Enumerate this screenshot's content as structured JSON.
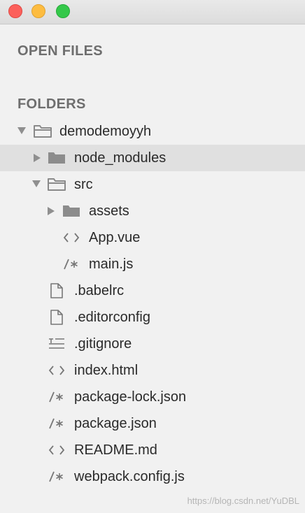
{
  "window": {
    "buttons": {
      "close": "close-button",
      "minimize": "minimize-button",
      "maximize": "zoom-button"
    }
  },
  "sidebar": {
    "open_files_title": "OPEN FILES",
    "folders_title": "FOLDERS",
    "tree": [
      {
        "label": "demodemoyyh",
        "type": "folder",
        "expanded": true,
        "icon": "folder-open-icon"
      },
      {
        "label": "node_modules",
        "type": "folder",
        "expanded": false,
        "selected": true,
        "icon": "folder-icon"
      },
      {
        "label": "src",
        "type": "folder",
        "expanded": true,
        "icon": "folder-open-icon"
      },
      {
        "label": "assets",
        "type": "folder",
        "expanded": false,
        "icon": "folder-icon"
      },
      {
        "label": "App.vue",
        "type": "file",
        "icon": "code-file-icon"
      },
      {
        "label": "main.js",
        "type": "file",
        "icon": "comment-file-icon"
      },
      {
        "label": ".babelrc",
        "type": "file",
        "icon": "document-icon"
      },
      {
        "label": ".editorconfig",
        "type": "file",
        "icon": "document-icon"
      },
      {
        "label": ".gitignore",
        "type": "file",
        "icon": "text-lines-icon"
      },
      {
        "label": "index.html",
        "type": "file",
        "icon": "code-file-icon"
      },
      {
        "label": "package-lock.json",
        "type": "file",
        "icon": "comment-file-icon"
      },
      {
        "label": "package.json",
        "type": "file",
        "icon": "comment-file-icon"
      },
      {
        "label": "README.md",
        "type": "file",
        "icon": "code-file-icon"
      },
      {
        "label": "webpack.config.js",
        "type": "file",
        "icon": "comment-file-icon"
      }
    ]
  },
  "watermark": "https://blog.csdn.net/YuDBL"
}
